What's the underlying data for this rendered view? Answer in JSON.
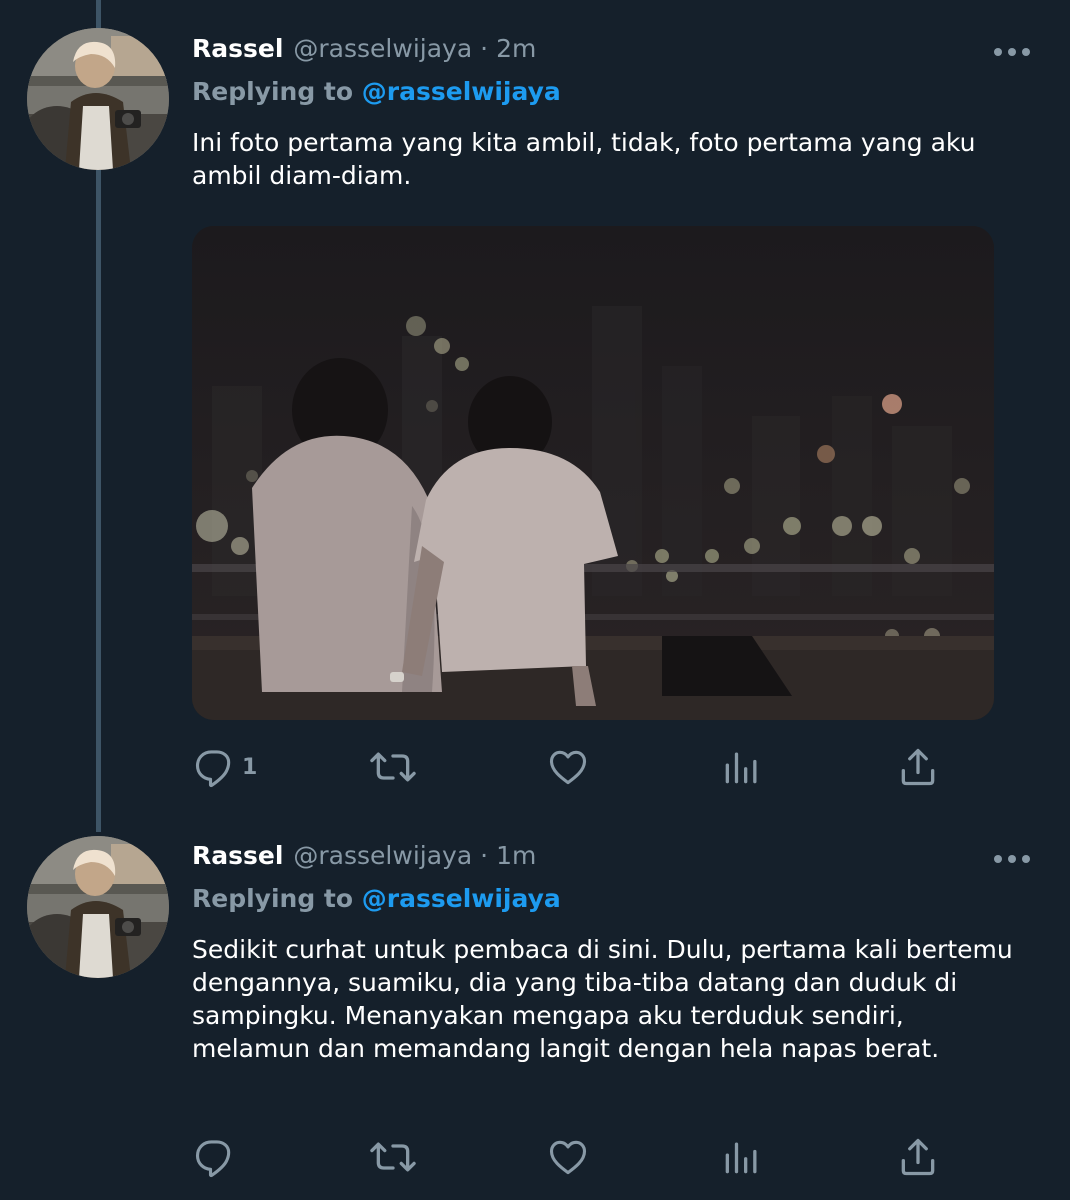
{
  "tweets": [
    {
      "name": "Rassel",
      "handle": "@rasselwijaya",
      "separator": "·",
      "time": "2m",
      "replying_prefix": "Replying to",
      "replying_mention": "@rasselwijaya",
      "text": "Ini foto pertama yang kita ambil, tidak, foto pertama yang aku ambil diam-diam.",
      "has_media": true,
      "reply_count": "1",
      "actions": [
        "reply-icon",
        "retweet-icon",
        "like-icon",
        "analytics-icon",
        "share-icon"
      ]
    },
    {
      "name": "Rassel",
      "handle": "@rasselwijaya",
      "separator": "·",
      "time": "1m",
      "replying_prefix": "Replying to",
      "replying_mention": "@rasselwijaya",
      "text": "Sedikit curhat untuk pembaca di sini. Dulu, pertama kali bertemu dengannya, suamiku, dia yang tiba-tiba datang dan duduk di sampingku. Menanyakan mengapa aku terduduk sendiri, melamun dan memandang langit dengan hela napas berat.",
      "has_media": false,
      "reply_count": "",
      "actions": [
        "reply-icon",
        "retweet-icon",
        "like-icon",
        "analytics-icon",
        "share-icon"
      ]
    }
  ],
  "colors": {
    "background": "#15202b",
    "secondary_text": "#8899a6",
    "mention": "#1d9bf0",
    "thread_line": "#3d5466"
  }
}
